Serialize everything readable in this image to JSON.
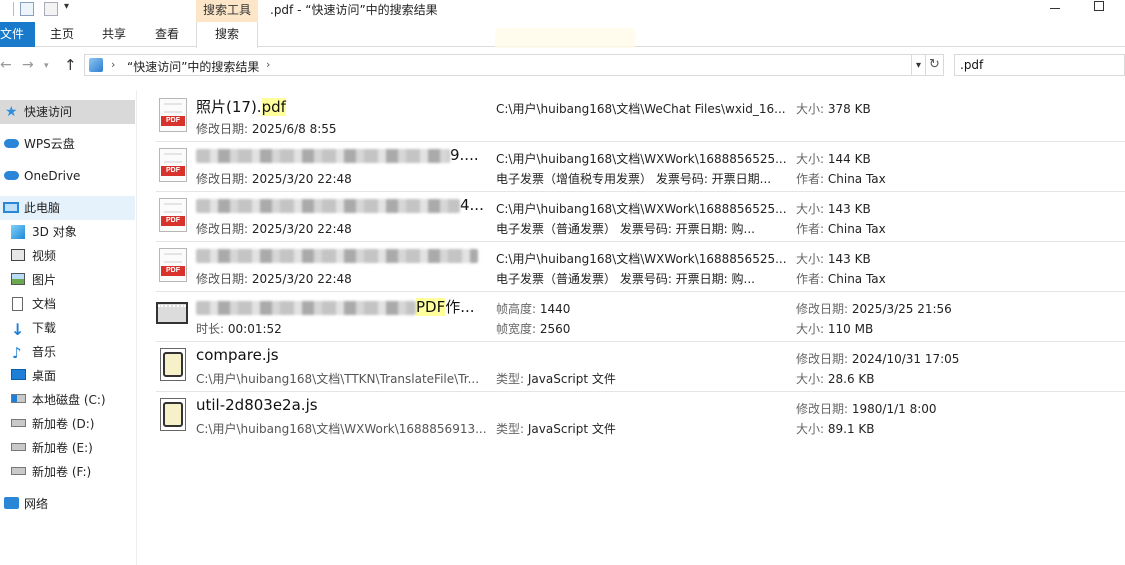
{
  "window": {
    "title": ".pdf - “快速访问”中的搜索结果",
    "tool_tab_header": "搜索工具"
  },
  "ribbon": {
    "tabs": [
      "文件",
      "主页",
      "共享",
      "查看",
      "搜索"
    ]
  },
  "address": {
    "path": "“快速访问”中的搜索结果",
    "search_value": ".pdf"
  },
  "sidebar": {
    "items": [
      {
        "label": "快速访问",
        "icon": "star-icon"
      },
      {
        "label": "WPS云盘",
        "icon": "cloud-icon"
      },
      {
        "label": "OneDrive",
        "icon": "onedrive-icon"
      },
      {
        "label": "此电脑",
        "icon": "computer-icon"
      },
      {
        "label": "3D 对象",
        "icon": "3d-objects-icon"
      },
      {
        "label": "视频",
        "icon": "video-folder-icon"
      },
      {
        "label": "图片",
        "icon": "pictures-folder-icon"
      },
      {
        "label": "文档",
        "icon": "documents-folder-icon"
      },
      {
        "label": "下载",
        "icon": "downloads-folder-icon"
      },
      {
        "label": "音乐",
        "icon": "music-folder-icon"
      },
      {
        "label": "桌面",
        "icon": "desktop-folder-icon"
      },
      {
        "label": "本地磁盘 (C:)",
        "icon": "local-disk-icon"
      },
      {
        "label": "新加卷 (D:)",
        "icon": "drive-icon"
      },
      {
        "label": "新加卷 (E:)",
        "icon": "drive-icon"
      },
      {
        "label": "新加卷 (F:)",
        "icon": "drive-icon"
      },
      {
        "label": "网络",
        "icon": "network-icon"
      }
    ]
  },
  "files": [
    {
      "name_pre": "照片(17).",
      "name_hl": "pdf",
      "sub_key": "修改日期:",
      "sub_val": "2025/6/8 8:55",
      "col2_l1": "C:\\用户\\huibang168\\文档\\WeChat Files\\wxid_16...",
      "col2_l2": "",
      "col3_l1_key": "大小:",
      "col3_l1_val": "378 KB",
      "col3_l2_key": "",
      "col3_l2_val": ""
    },
    {
      "name_tail": "9....",
      "sub_key": "修改日期:",
      "sub_val": "2025/3/20 22:48",
      "col2_l1": "C:\\用户\\huibang168\\文档\\WXWork\\1688856525...",
      "col2_l2": "电子发票（增值税专用发票） 发票号码: 开票日期...",
      "col3_l1_key": "大小:",
      "col3_l1_val": "144 KB",
      "col3_l2_key": "作者:",
      "col3_l2_val": "China Tax"
    },
    {
      "name_tail": "4...",
      "sub_key": "修改日期:",
      "sub_val": "2025/3/20 22:48",
      "col2_l1": "C:\\用户\\huibang168\\文档\\WXWork\\1688856525...",
      "col2_l2": "电子发票（普通发票） 发票号码: 开票日期: 购...",
      "col3_l1_key": "大小:",
      "col3_l1_val": "143 KB",
      "col3_l2_key": "作者:",
      "col3_l2_val": "China Tax"
    },
    {
      "name_tail": "",
      "sub_key": "修改日期:",
      "sub_val": "2025/3/20 22:48",
      "col2_l1": "C:\\用户\\huibang168\\文档\\WXWork\\1688856525...",
      "col2_l2": "电子发票（普通发票） 发票号码: 开票日期: 购...",
      "col3_l1_key": "大小:",
      "col3_l1_val": "143 KB",
      "col3_l2_key": "作者:",
      "col3_l2_val": "China Tax"
    },
    {
      "name_hl": "PDF",
      "name_tail": "作...",
      "sub_key": "时长:",
      "sub_val": "00:01:52",
      "col2_l1_key": "帧高度:",
      "col2_l1_val": "1440",
      "col2_l2_key": "帧宽度:",
      "col2_l2_val": "2560",
      "col3_l1_key": "修改日期:",
      "col3_l1_val": "2025/3/25 21:56",
      "col3_l2_key": "大小:",
      "col3_l2_val": "110 MB"
    },
    {
      "name": "compare.js",
      "sub_path": "C:\\用户\\huibang168\\文档\\TTKN\\TranslateFile\\Tr...",
      "col2_l2_key": "类型:",
      "col2_l2_val": "JavaScript 文件",
      "col3_l1_key": "修改日期:",
      "col3_l1_val": "2024/10/31 17:05",
      "col3_l2_key": "大小:",
      "col3_l2_val": "28.6 KB"
    },
    {
      "name": "util-2d803e2a.js",
      "sub_path": "C:\\用户\\huibang168\\文档\\WXWork\\1688856913...",
      "col2_l2_key": "类型:",
      "col2_l2_val": "JavaScript 文件",
      "col3_l1_key": "修改日期:",
      "col3_l1_val": "1980/1/1 8:00",
      "col3_l2_key": "大小:",
      "col3_l2_val": "89.1 KB"
    }
  ],
  "colors": {
    "accent": "#1979ca",
    "tool_tab": "#fde6c8",
    "highlight": "#ffff9c",
    "pdf_red": "#d8322c"
  }
}
